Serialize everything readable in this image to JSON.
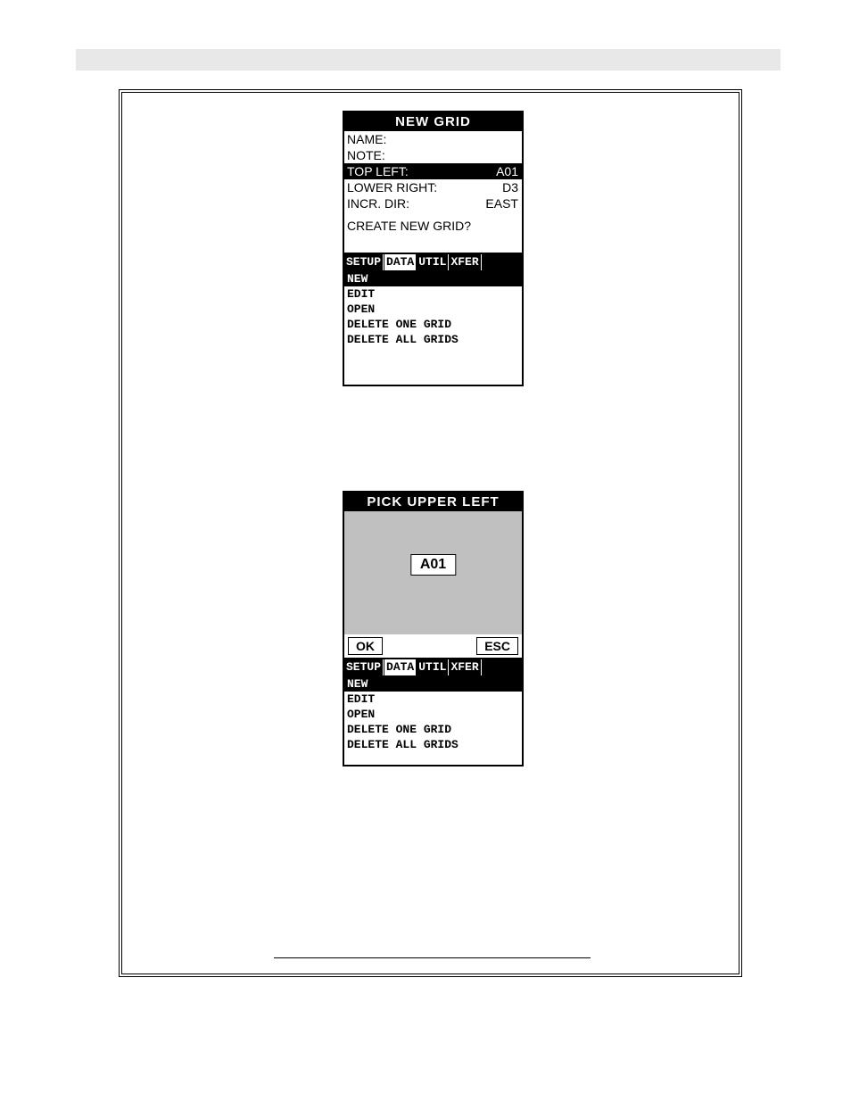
{
  "screen1": {
    "title": "NEW GRID",
    "fields": [
      {
        "label": "NAME:",
        "value": ""
      },
      {
        "label": "NOTE:",
        "value": ""
      },
      {
        "label": "TOP LEFT:",
        "value": "A01",
        "selected": true
      },
      {
        "label": "LOWER RIGHT:",
        "value": "D3"
      },
      {
        "label": "INCR. DIR:",
        "value": "EAST"
      }
    ],
    "prompt": "CREATE NEW GRID?",
    "tabs": [
      "SETUP",
      "DATA",
      "UTIL",
      "XFER"
    ],
    "active_tab": "DATA",
    "menu": [
      "NEW",
      "EDIT",
      "OPEN",
      "DELETE ONE GRID",
      "DELETE ALL GRIDS"
    ],
    "menu_selected": "NEW"
  },
  "screen2": {
    "title": "PICK UPPER LEFT",
    "value": "A01",
    "ok": "OK",
    "esc": "ESC",
    "tabs": [
      "SETUP",
      "DATA",
      "UTIL",
      "XFER"
    ],
    "active_tab": "DATA",
    "menu": [
      "NEW",
      "EDIT",
      "OPEN",
      "DELETE ONE GRID",
      "DELETE ALL GRIDS"
    ],
    "menu_selected": "NEW"
  }
}
